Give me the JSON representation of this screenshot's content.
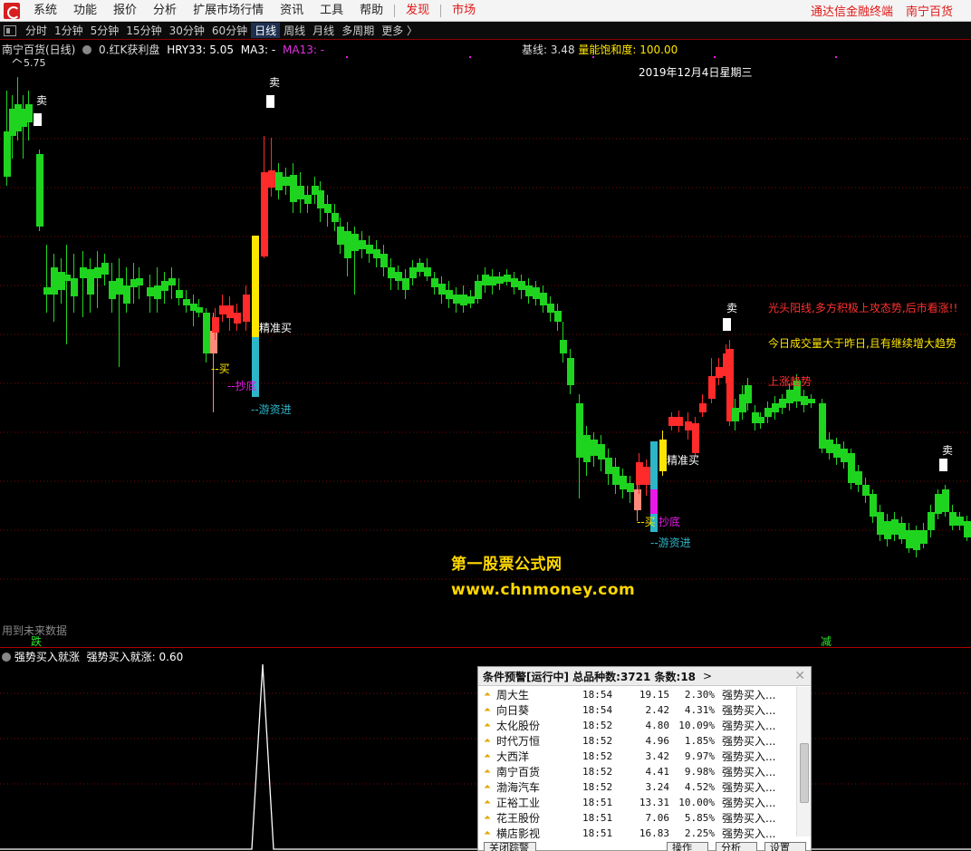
{
  "menu": {
    "items": [
      "系统",
      "功能",
      "报价",
      "分析",
      "扩展市场行情",
      "资讯",
      "工具",
      "帮助"
    ],
    "highlight": [
      "发现",
      "市场"
    ],
    "right": [
      "通达信金融终端",
      "南宁百货"
    ]
  },
  "period_bar": {
    "items": [
      "分时",
      "1分钟",
      "5分钟",
      "15分钟",
      "30分钟",
      "60分钟",
      "日线",
      "周线",
      "月线",
      "多周期",
      "更多 〉"
    ],
    "active": "日线"
  },
  "chart": {
    "title": "南宁百货(日线)",
    "indicator_name": "0.红K获利盘",
    "hry": "HRY33: 5.05",
    "ma3": "MA3: -",
    "ma13": "MA13: -",
    "base": "基线: 3.48",
    "saturation": "量能饱和度: 100.00",
    "date": "2019年12月4日星期三",
    "high_price": "5.75",
    "future_data": "用到未来数据",
    "watermark_cn": "第一股票公式网",
    "watermark_url": "www.chnmoney.com",
    "note_1": "光头阳线,多方积极上攻态势,后市看涨!!",
    "note_2": "今日成交量大于昨日,且有继续增大趋势",
    "note_3": "上涨趋势",
    "markers": {
      "sell": "卖",
      "buy": "--买",
      "precise_buy": "精准买",
      "bottom": "--抄底",
      "bottom2": "抄底",
      "hot_money": "--游资进",
      "down": "跌",
      "reduce": "减"
    },
    "colors": {
      "up": "#ff2a2a",
      "down": "#1fd41f",
      "yellow": "#ffe600",
      "cyan": "#2cb6c8",
      "magenta": "#e818e8",
      "salmon": "#ff8a7a"
    }
  },
  "indicator": {
    "title": "强势买入就涨",
    "value": "强势买入就涨: 0.60"
  },
  "alert": {
    "header": "条件预警[运行中] 总品种数:3721 条数:18",
    "chevron": ">",
    "close": "✕",
    "rows": [
      {
        "name": "周大生",
        "time": "18:54",
        "price": "19.15",
        "pct": "2.30%",
        "type": "强势买入..."
      },
      {
        "name": "向日葵",
        "time": "18:54",
        "price": "2.42",
        "pct": "4.31%",
        "type": "强势买入..."
      },
      {
        "name": "太化股份",
        "time": "18:52",
        "price": "4.80",
        "pct": "10.09%",
        "type": "强势买入..."
      },
      {
        "name": "时代万恒",
        "time": "18:52",
        "price": "4.96",
        "pct": "1.85%",
        "type": "强势买入..."
      },
      {
        "name": "大西洋",
        "time": "18:52",
        "price": "3.42",
        "pct": "9.97%",
        "type": "强势买入..."
      },
      {
        "name": "南宁百货",
        "time": "18:52",
        "price": "4.41",
        "pct": "9.98%",
        "type": "强势买入..."
      },
      {
        "name": "渤海汽车",
        "time": "18:52",
        "price": "3.24",
        "pct": "4.52%",
        "type": "强势买入..."
      },
      {
        "name": "正裕工业",
        "time": "18:51",
        "price": "13.31",
        "pct": "10.00%",
        "type": "强势买入..."
      },
      {
        "name": "花王股份",
        "time": "18:51",
        "price": "7.06",
        "pct": "5.85%",
        "type": "强势买入..."
      },
      {
        "name": "横店影视",
        "time": "18:51",
        "price": "16.83",
        "pct": "2.25%",
        "type": "强势买入..."
      }
    ],
    "buttons": [
      "关闭踪警",
      "操作",
      "分析",
      "设置"
    ]
  }
}
